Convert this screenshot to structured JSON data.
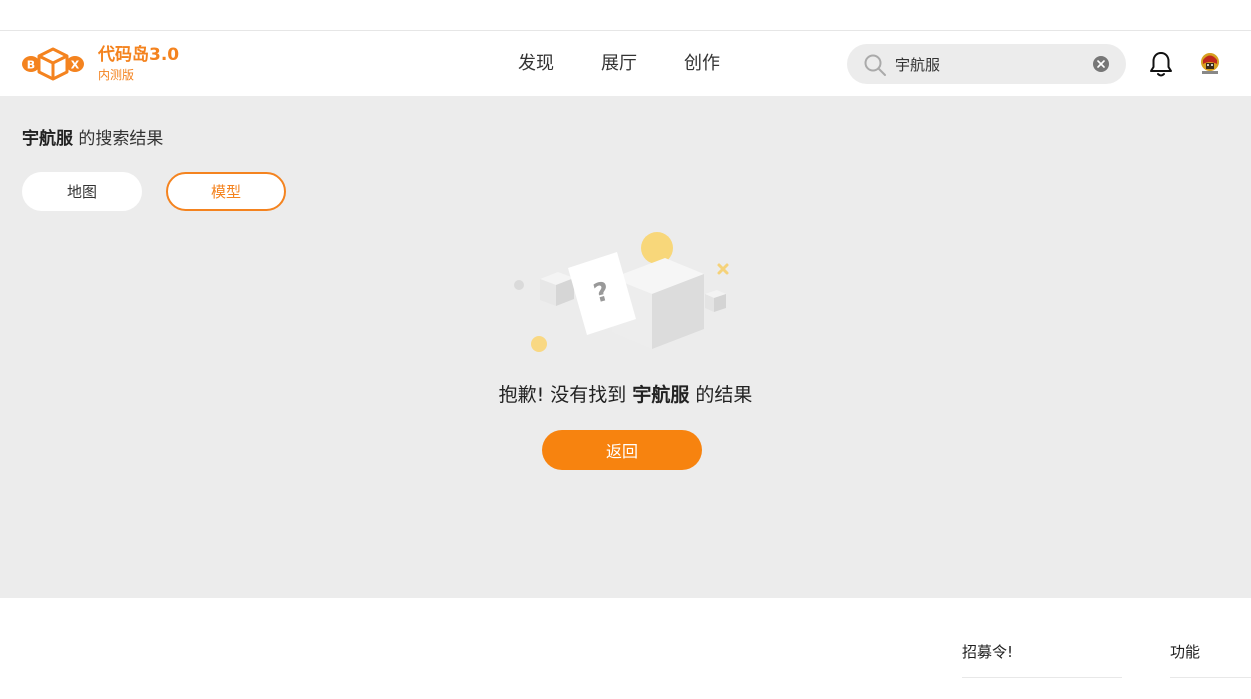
{
  "header": {
    "brand_name": "代码岛3.0",
    "brand_sub": "内测版",
    "logo_letters": [
      "B",
      "X"
    ],
    "nav": [
      {
        "label": "发现"
      },
      {
        "label": "展厅"
      },
      {
        "label": "创作"
      }
    ],
    "search": {
      "value": "宇航服",
      "icon": "search-icon"
    },
    "notification_icon": "bell-icon",
    "accent_color": "#f4831f"
  },
  "results": {
    "query": "宇航服",
    "title_suffix": "的搜索结果",
    "tabs": [
      {
        "label": "地图",
        "active": false
      },
      {
        "label": "模型",
        "active": true
      }
    ],
    "empty": {
      "prefix": "抱歉! 没有找到",
      "query": "宇航服",
      "suffix": "的结果",
      "illustration_mark": "?"
    },
    "back_label": "返回"
  },
  "footer": {
    "columns": [
      {
        "label": "招募令!"
      },
      {
        "label": "功能"
      }
    ]
  }
}
